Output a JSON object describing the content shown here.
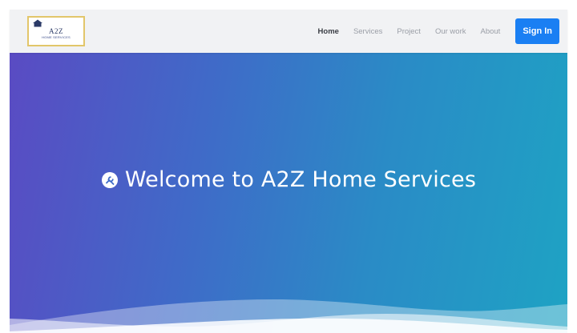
{
  "logo": {
    "title": "A2Z",
    "subtitle": "HOME SERVICES"
  },
  "nav": {
    "items": [
      {
        "label": "Home",
        "active": true
      },
      {
        "label": "Services",
        "active": false
      },
      {
        "label": "Project",
        "active": false
      },
      {
        "label": "Our work",
        "active": false
      },
      {
        "label": "About",
        "active": false
      }
    ],
    "signin_label": "Sign In"
  },
  "hero": {
    "title": "Welcome to A2Z Home Services",
    "icon": "tools-circle-icon"
  },
  "colors": {
    "accent": "#1a7ff3",
    "navbar_bg": "#f1f2f4",
    "hero_gradient_start": "#5a4bc3",
    "hero_gradient_end": "#1ea3c4"
  }
}
